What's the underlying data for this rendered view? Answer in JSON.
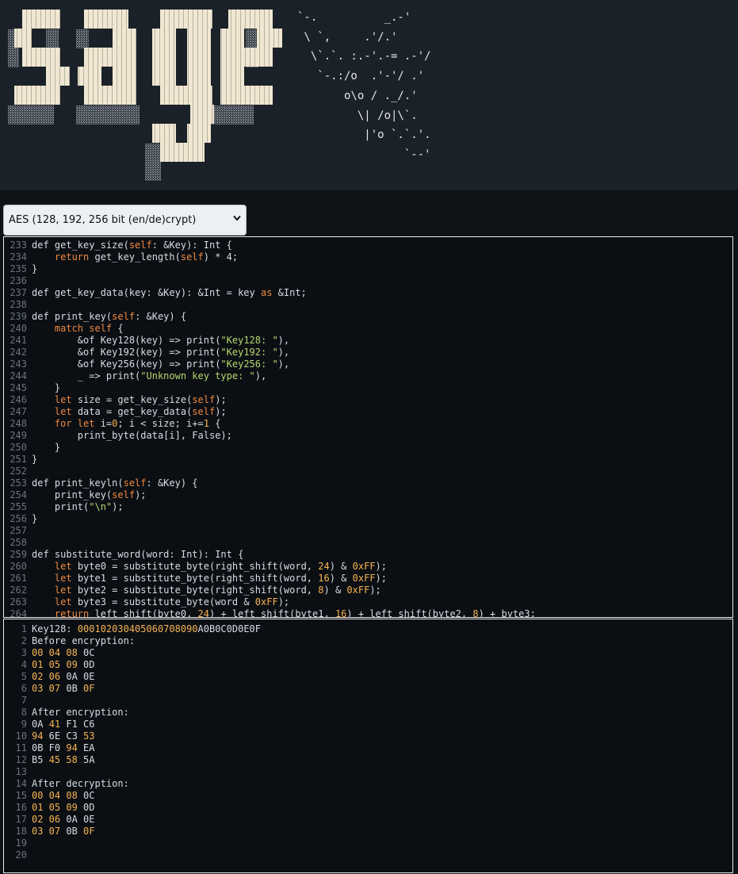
{
  "banner": {
    "ascii_art": [
      "`-.          _.-'",
      " \\ `,     .'/.'",
      "  \\`.`. :.-'.-= .-'/",
      "   `-.:/o  .'-'/ .'",
      "       o\\o / ._/.'",
      "         \\| /o|\\`.",
      "          |'o `.`.'.",
      "                `--'"
    ]
  },
  "selector": {
    "value": "AES (128, 192, 256 bit (en/de)crypt)",
    "icon": "chevron-down-icon"
  },
  "editor": {
    "first_partial_line": "232",
    "lines": [
      {
        "n": "233",
        "segs": [
          [
            "",
            "def get_key_size("
          ],
          [
            "kw",
            "self"
          ],
          [
            "",
            ": &Key): Int {"
          ]
        ]
      },
      {
        "n": "234",
        "segs": [
          [
            "",
            "    "
          ],
          [
            "kw",
            "return"
          ],
          [
            "",
            " get_key_length("
          ],
          [
            "kw",
            "self"
          ],
          [
            "",
            ") * 4;"
          ]
        ]
      },
      {
        "n": "235",
        "segs": [
          [
            "",
            "}"
          ]
        ]
      },
      {
        "n": "236",
        "segs": []
      },
      {
        "n": "237",
        "segs": [
          [
            "",
            "def get_key_data(key: &Key): &Int = key "
          ],
          [
            "kw",
            "as"
          ],
          [
            "",
            " &Int;"
          ]
        ]
      },
      {
        "n": "238",
        "segs": []
      },
      {
        "n": "239",
        "segs": [
          [
            "",
            "def print_key("
          ],
          [
            "kw",
            "self"
          ],
          [
            "",
            ": &Key) {"
          ]
        ]
      },
      {
        "n": "240",
        "segs": [
          [
            "",
            "    "
          ],
          [
            "kw",
            "match self"
          ],
          [
            "",
            " {"
          ]
        ]
      },
      {
        "n": "241",
        "segs": [
          [
            "",
            "        &of Key128(key) => print("
          ],
          [
            "str",
            "\"Key128: \""
          ],
          [
            "",
            "),"
          ]
        ]
      },
      {
        "n": "242",
        "segs": [
          [
            "",
            "        &of Key192(key) => print("
          ],
          [
            "str",
            "\"Key192: \""
          ],
          [
            "",
            "),"
          ]
        ]
      },
      {
        "n": "243",
        "segs": [
          [
            "",
            "        &of Key256(key) => print("
          ],
          [
            "str",
            "\"Key256: \""
          ],
          [
            "",
            "),"
          ]
        ]
      },
      {
        "n": "244",
        "segs": [
          [
            "",
            "        _ => print("
          ],
          [
            "str",
            "\"Unknown key type: \""
          ],
          [
            "",
            "),"
          ]
        ]
      },
      {
        "n": "245",
        "segs": [
          [
            "",
            "    }"
          ]
        ]
      },
      {
        "n": "246",
        "segs": [
          [
            "",
            "    "
          ],
          [
            "kw",
            "let"
          ],
          [
            "",
            " size = get_key_size("
          ],
          [
            "kw",
            "self"
          ],
          [
            "",
            ");"
          ]
        ]
      },
      {
        "n": "247",
        "segs": [
          [
            "",
            "    "
          ],
          [
            "kw",
            "let"
          ],
          [
            "",
            " data = get_key_data("
          ],
          [
            "kw",
            "self"
          ],
          [
            "",
            ");"
          ]
        ]
      },
      {
        "n": "248",
        "segs": [
          [
            "",
            "    "
          ],
          [
            "kw",
            "for let"
          ],
          [
            "",
            " i="
          ],
          [
            "num",
            "0"
          ],
          [
            "",
            "; i < size; i+="
          ],
          [
            "num",
            "1"
          ],
          [
            "",
            " {"
          ]
        ]
      },
      {
        "n": "249",
        "segs": [
          [
            "",
            "        print_byte(data[i], False);"
          ]
        ]
      },
      {
        "n": "250",
        "segs": [
          [
            "",
            "    }"
          ]
        ]
      },
      {
        "n": "251",
        "segs": [
          [
            "",
            "}"
          ]
        ]
      },
      {
        "n": "252",
        "segs": []
      },
      {
        "n": "253",
        "segs": [
          [
            "",
            "def print_keyln("
          ],
          [
            "kw",
            "self"
          ],
          [
            "",
            ": &Key) {"
          ]
        ]
      },
      {
        "n": "254",
        "segs": [
          [
            "",
            "    print_key("
          ],
          [
            "kw",
            "self"
          ],
          [
            "",
            ");"
          ]
        ]
      },
      {
        "n": "255",
        "segs": [
          [
            "",
            "    print("
          ],
          [
            "str",
            "\"\\n\""
          ],
          [
            "",
            ");"
          ]
        ]
      },
      {
        "n": "256",
        "segs": [
          [
            "",
            "}"
          ]
        ]
      },
      {
        "n": "257",
        "segs": []
      },
      {
        "n": "258",
        "segs": []
      },
      {
        "n": "259",
        "segs": [
          [
            "",
            "def substitute_word(word: Int): Int {"
          ]
        ]
      },
      {
        "n": "260",
        "segs": [
          [
            "",
            "    "
          ],
          [
            "kw",
            "let"
          ],
          [
            "",
            " byte0 = substitute_byte(right_shift(word, "
          ],
          [
            "num",
            "24"
          ],
          [
            "",
            ") & "
          ],
          [
            "num",
            "0xFF"
          ],
          [
            "",
            ");"
          ]
        ]
      },
      {
        "n": "261",
        "segs": [
          [
            "",
            "    "
          ],
          [
            "kw",
            "let"
          ],
          [
            "",
            " byte1 = substitute_byte(right_shift(word, "
          ],
          [
            "num",
            "16"
          ],
          [
            "",
            ") & "
          ],
          [
            "num",
            "0xFF"
          ],
          [
            "",
            ");"
          ]
        ]
      },
      {
        "n": "262",
        "segs": [
          [
            "",
            "    "
          ],
          [
            "kw",
            "let"
          ],
          [
            "",
            " byte2 = substitute_byte(right_shift(word, "
          ],
          [
            "num",
            "8"
          ],
          [
            "",
            ") & "
          ],
          [
            "num",
            "0xFF"
          ],
          [
            "",
            ");"
          ]
        ]
      },
      {
        "n": "263",
        "segs": [
          [
            "",
            "    "
          ],
          [
            "kw",
            "let"
          ],
          [
            "",
            " byte3 = substitute_byte(word & "
          ],
          [
            "num",
            "0xFF"
          ],
          [
            "",
            ");"
          ]
        ]
      },
      {
        "n": "264",
        "segs": [
          [
            "",
            "    "
          ],
          [
            "kw",
            "return"
          ],
          [
            "",
            " left_shift(byte0, "
          ],
          [
            "num",
            "24"
          ],
          [
            "",
            ") + left_shift(byte1, "
          ],
          [
            "num",
            "16"
          ],
          [
            "",
            ") + left_shift(byte2, "
          ],
          [
            "num",
            "8"
          ],
          [
            "",
            ") + byte3;"
          ]
        ]
      }
    ]
  },
  "output": {
    "lines": [
      {
        "n": "1",
        "segs": [
          [
            "",
            "Key128: "
          ],
          [
            "hx",
            "000102030405060708090"
          ],
          [
            "",
            "A0B0C0D0E0F"
          ]
        ]
      },
      {
        "n": "2",
        "segs": [
          [
            "",
            "Before encryption:"
          ]
        ]
      },
      {
        "n": "3",
        "segs": [
          [
            "hx",
            "00 04 08"
          ],
          [
            "",
            " 0C"
          ]
        ]
      },
      {
        "n": "4",
        "segs": [
          [
            "hx",
            "01 05 09"
          ],
          [
            "",
            " 0D"
          ]
        ]
      },
      {
        "n": "5",
        "segs": [
          [
            "hx",
            "02 06"
          ],
          [
            "",
            " 0A 0E"
          ]
        ]
      },
      {
        "n": "6",
        "segs": [
          [
            "hx",
            "03 07"
          ],
          [
            "",
            " 0B "
          ],
          [
            "hx",
            "0F"
          ]
        ]
      },
      {
        "n": "7",
        "segs": []
      },
      {
        "n": "8",
        "segs": [
          [
            "",
            "After encryption:"
          ]
        ]
      },
      {
        "n": "9",
        "segs": [
          [
            "",
            "0A "
          ],
          [
            "hx",
            "41"
          ],
          [
            "",
            " F1 C6"
          ]
        ]
      },
      {
        "n": "10",
        "segs": [
          [
            "hx",
            "94"
          ],
          [
            "",
            " 6E C3 "
          ],
          [
            "hx",
            "53"
          ]
        ]
      },
      {
        "n": "11",
        "segs": [
          [
            "",
            "0B F0 "
          ],
          [
            "hx",
            "94"
          ],
          [
            "",
            " EA"
          ]
        ]
      },
      {
        "n": "12",
        "segs": [
          [
            "",
            "B5 "
          ],
          [
            "hx",
            "45 58"
          ],
          [
            "",
            " 5A"
          ]
        ]
      },
      {
        "n": "13",
        "segs": []
      },
      {
        "n": "14",
        "segs": [
          [
            "",
            "After decryption:"
          ]
        ]
      },
      {
        "n": "15",
        "segs": [
          [
            "hx",
            "00 04 08"
          ],
          [
            "",
            " 0C"
          ]
        ]
      },
      {
        "n": "16",
        "segs": [
          [
            "hx",
            "01 05 09"
          ],
          [
            "",
            " 0D"
          ]
        ]
      },
      {
        "n": "17",
        "segs": [
          [
            "hx",
            "02 06"
          ],
          [
            "",
            " 0A 0E"
          ]
        ]
      },
      {
        "n": "18",
        "segs": [
          [
            "hx",
            "03 07"
          ],
          [
            "",
            " 0B "
          ],
          [
            "hx",
            "0F"
          ]
        ]
      },
      {
        "n": "19",
        "segs": []
      },
      {
        "n": "20",
        "segs": []
      }
    ]
  }
}
